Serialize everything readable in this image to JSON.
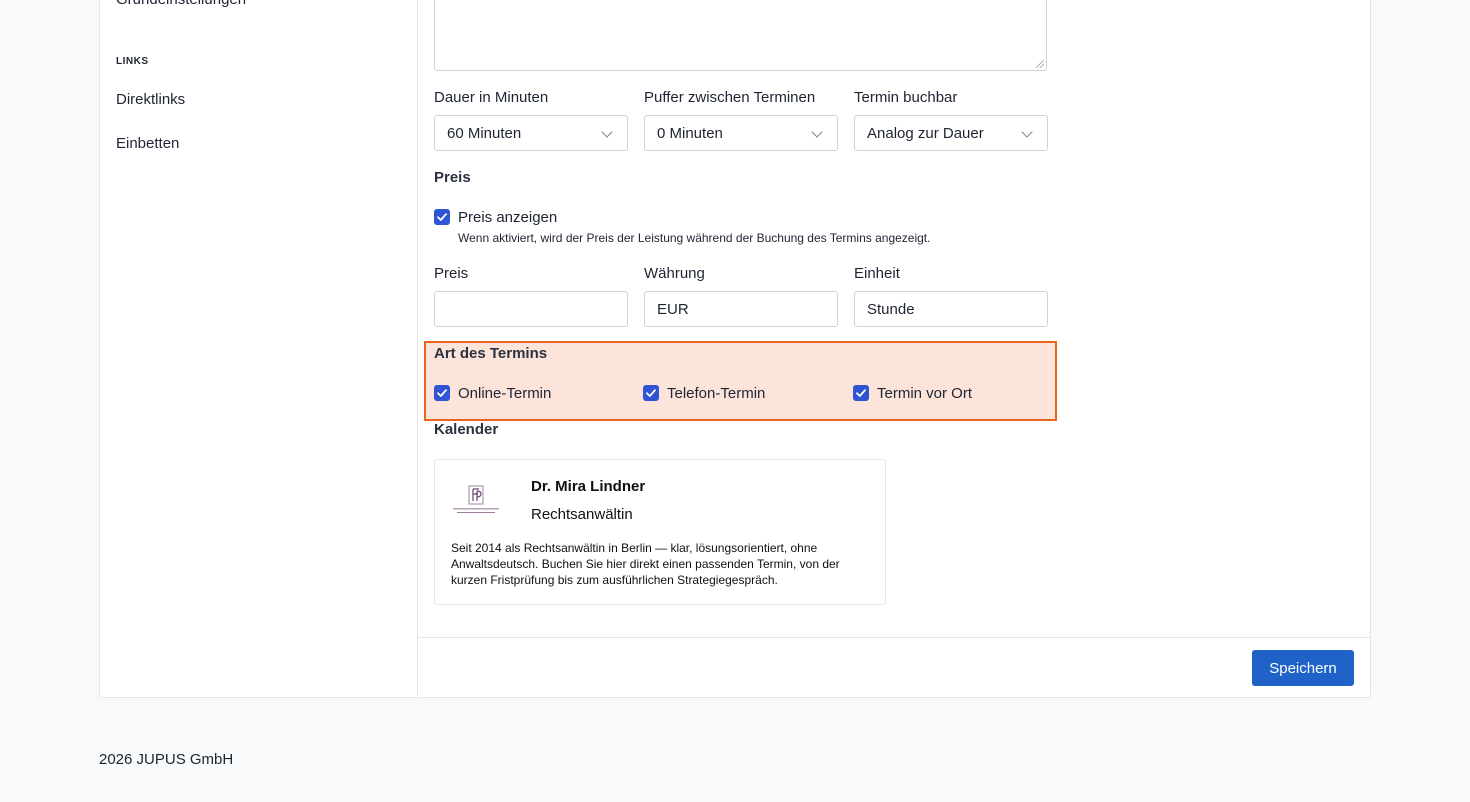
{
  "sidebar": {
    "partial_item": "Grundeinstellungen",
    "links_heading": "LINKS",
    "items": [
      {
        "label": "Direktlinks"
      },
      {
        "label": "Einbetten"
      }
    ]
  },
  "form": {
    "duration": {
      "label": "Dauer in Minuten",
      "value": "60 Minuten"
    },
    "buffer": {
      "label": "Puffer zwischen Terminen",
      "value": "0 Minuten"
    },
    "bookable": {
      "label": "Termin buchbar",
      "value": "Analog zur Dauer"
    },
    "price_section": {
      "title": "Preis",
      "show_price_label": "Preis anzeigen",
      "show_price_help": "Wenn aktiviert, wird der Preis der Leistung während der Buchung des Termins angezeigt.",
      "price": {
        "label": "Preis",
        "value": ""
      },
      "currency": {
        "label": "Währung",
        "value": "EUR"
      },
      "unit": {
        "label": "Einheit",
        "value": "Stunde"
      }
    },
    "appointment_type": {
      "title": "Art des Termins",
      "options": [
        {
          "label": "Online-Termin",
          "checked": true
        },
        {
          "label": "Telefon-Termin",
          "checked": true
        },
        {
          "label": "Termin vor Ort",
          "checked": true
        }
      ]
    },
    "calendar": {
      "title": "Kalender",
      "name": "Dr. Mira Lindner",
      "role": "Rechtsanwältin",
      "description": "Seit 2014 als Rechtsanwältin in Berlin — klar, lösungsorientiert, ohne Anwaltsdeutsch. Buchen Sie hier direkt einen passenden Termin, von der kurzen Fristprüfung bis zum ausführlichen Strategiegespräch."
    },
    "save_label": "Speichern"
  },
  "footer": {
    "copyright": "2026 JUPUS GmbH"
  },
  "colors": {
    "primary": "#1f63c8",
    "checkbox": "#2f55d4",
    "highlight_bg": "#fde4da",
    "highlight_border": "#e8651f"
  }
}
